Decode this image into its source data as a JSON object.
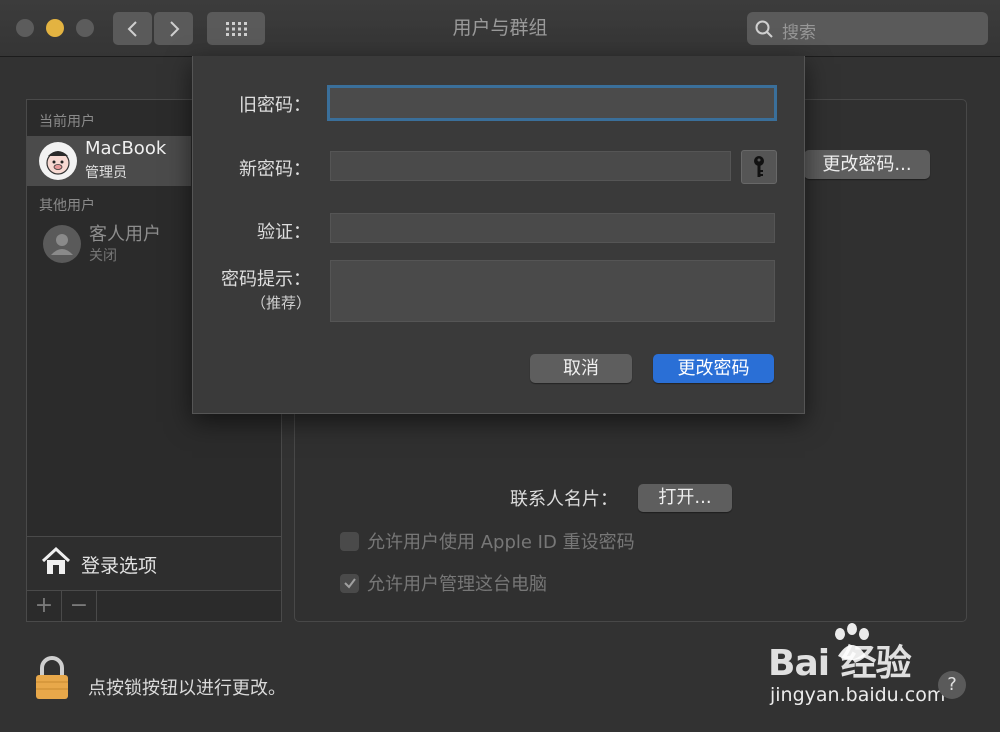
{
  "window": {
    "title": "用户与群组"
  },
  "search": {
    "placeholder": "搜索"
  },
  "sidebar": {
    "current_header": "当前用户",
    "current_user": {
      "name": "MacBook",
      "role": "管理员"
    },
    "other_header": "其他用户",
    "guest_user": {
      "name": "客人用户",
      "status": "关闭"
    },
    "login_options": "登录选项",
    "add_label": "+",
    "remove_label": "−"
  },
  "main": {
    "change_password_button": "更改密码...",
    "contact_card_label": "联系人名片：",
    "open_button": "打开...",
    "checkbox_reset": "允许用户使用 Apple ID 重设密码",
    "checkbox_admin": "允许用户管理这台电脑"
  },
  "dialog": {
    "old_password_label": "旧密码：",
    "new_password_label": "新密码：",
    "verify_label": "验证：",
    "hint_label": "密码提示：",
    "hint_sub": "（推荐）",
    "old_password_value": "",
    "new_password_value": "",
    "verify_value": "",
    "hint_value": "",
    "cancel_button": "取消",
    "confirm_button": "更改密码"
  },
  "footer": {
    "lock_text": "点按锁按钮以进行更改。",
    "help": "?"
  },
  "watermark": {
    "logo": "Bai  经验",
    "url": "jingyan.baidu.com"
  },
  "colors": {
    "accent": "#2a6fd6",
    "focus_ring": "#3a6f9a",
    "minimize": "#e3b341",
    "lock": "#e8a84a"
  }
}
